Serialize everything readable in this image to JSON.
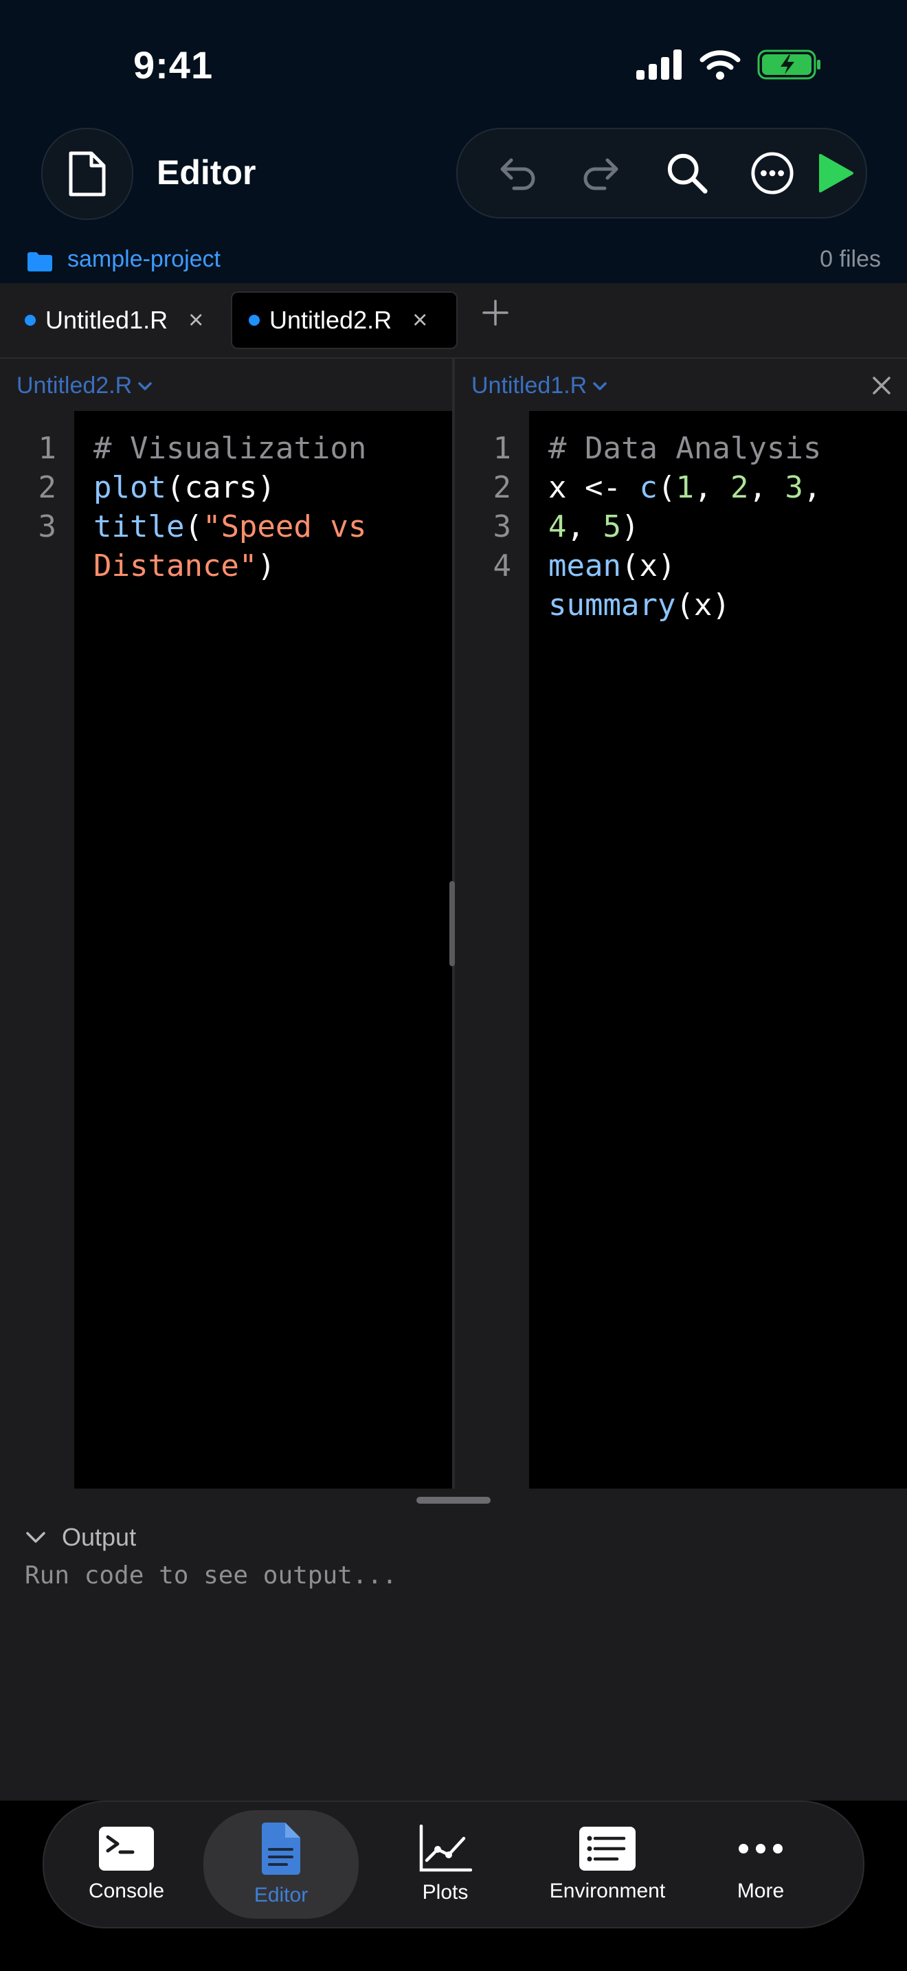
{
  "status": {
    "time": "9:41"
  },
  "header": {
    "title": "Editor"
  },
  "project": {
    "name": "sample-project",
    "file_count": "0 files"
  },
  "tabs": [
    {
      "label": "Untitled1.R",
      "active": false
    },
    {
      "label": "Untitled2.R",
      "active": true
    }
  ],
  "panes": {
    "left": {
      "title": "Untitled2.R",
      "line_numbers": [
        "1",
        "2",
        "3"
      ],
      "lines": [
        [
          {
            "t": "# Visualization",
            "c": "cm"
          }
        ],
        [
          {
            "t": "plot",
            "c": "fn"
          },
          {
            "t": "(cars)",
            "c": "pl"
          }
        ],
        [
          {
            "t": "title",
            "c": "fn"
          },
          {
            "t": "(",
            "c": "pl"
          },
          {
            "t": "\"Speed vs",
            "c": "st"
          }
        ],
        [
          {
            "t": "Distance\"",
            "c": "st"
          },
          {
            "t": ")",
            "c": "pl"
          }
        ]
      ]
    },
    "right": {
      "title": "Untitled1.R",
      "line_numbers": [
        "1",
        "2",
        "3",
        "4"
      ],
      "lines": [
        [
          {
            "t": "# Data Analysis",
            "c": "cm"
          }
        ],
        [
          {
            "t": "x <- ",
            "c": "pl"
          },
          {
            "t": "c",
            "c": "fn"
          },
          {
            "t": "(",
            "c": "pl"
          },
          {
            "t": "1",
            "c": "nm"
          },
          {
            "t": ", ",
            "c": "pl"
          },
          {
            "t": "2",
            "c": "nm"
          },
          {
            "t": ", ",
            "c": "pl"
          },
          {
            "t": "3",
            "c": "nm"
          },
          {
            "t": ",",
            "c": "pl"
          }
        ],
        [
          {
            "t": "4",
            "c": "nm"
          },
          {
            "t": ", ",
            "c": "pl"
          },
          {
            "t": "5",
            "c": "nm"
          },
          {
            "t": ")",
            "c": "pl"
          }
        ],
        [
          {
            "t": "mean",
            "c": "fn"
          },
          {
            "t": "(x)",
            "c": "pl"
          }
        ],
        [
          {
            "t": "summary",
            "c": "fn"
          },
          {
            "t": "(x)",
            "c": "pl"
          }
        ]
      ]
    }
  },
  "output": {
    "label": "Output",
    "placeholder": "Run code to see output..."
  },
  "nav": [
    {
      "label": "Console",
      "icon": "terminal-icon",
      "active": false
    },
    {
      "label": "Editor",
      "icon": "document-icon",
      "active": true
    },
    {
      "label": "Plots",
      "icon": "chart-line-icon",
      "active": false
    },
    {
      "label": "Environment",
      "icon": "list-icon",
      "active": false
    },
    {
      "label": "More",
      "icon": "ellipsis-icon",
      "active": false
    }
  ],
  "colors": {
    "accent": "#3e9bff",
    "run": "#30d158",
    "battery": "#30c04f"
  }
}
